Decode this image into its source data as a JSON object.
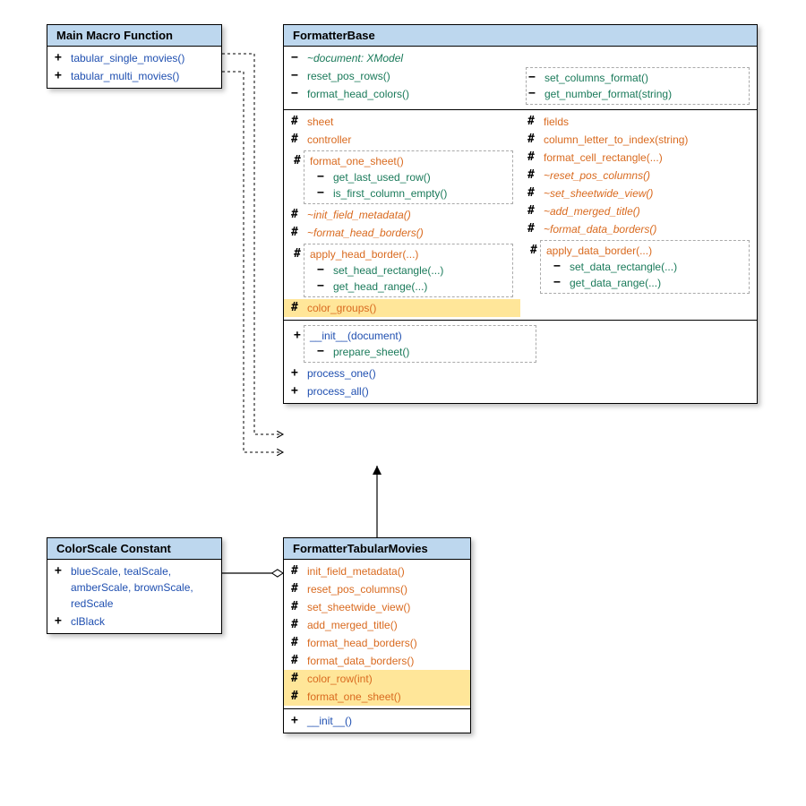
{
  "mainMacro": {
    "title": "Main Macro Function",
    "items": [
      {
        "vis": "+",
        "label": "tabular_single_movies()",
        "cls": "c-public"
      },
      {
        "vis": "+",
        "label": "tabular_multi_movies()",
        "cls": "c-public"
      }
    ]
  },
  "formatterBase": {
    "title": "FormatterBase",
    "privSection": {
      "left": {
        "doc": {
          "vis": "−",
          "label": "~document: XModel",
          "cls": "c-private ital"
        },
        "reset": {
          "vis": "−",
          "label": "reset_pos_rows()",
          "cls": "c-private"
        },
        "fhc": {
          "vis": "−",
          "label": "format_head_colors()",
          "cls": "c-private"
        }
      },
      "right": {
        "scf": {
          "vis": "−",
          "label": "set_columns_format()",
          "cls": "c-private"
        },
        "gnf": {
          "vis": "−",
          "label": "get_number_format(string)",
          "cls": "c-private"
        }
      }
    },
    "protSection": {
      "left": [
        {
          "vis": "#",
          "label": "sheet",
          "cls": "c-protected"
        },
        {
          "vis": "#",
          "label": "controller",
          "cls": "c-protected"
        }
      ],
      "leftNest1": {
        "head": {
          "vis": "#",
          "label": "format_one_sheet()",
          "cls": "c-protected"
        },
        "items": [
          {
            "vis": "−",
            "label": "get_last_used_row()",
            "cls": "c-private"
          },
          {
            "vis": "−",
            "label": "is_first_column_empty()",
            "cls": "c-private"
          }
        ]
      },
      "leftAfter": [
        {
          "vis": "#",
          "label": "~init_field_metadata()",
          "cls": "c-protected ital"
        },
        {
          "vis": "#",
          "label": "~format_head_borders()",
          "cls": "c-protected ital"
        }
      ],
      "leftNest2": {
        "head": {
          "vis": "#",
          "label": "apply_head_border(...)",
          "cls": "c-protected"
        },
        "items": [
          {
            "vis": "−",
            "label": "set_head_rectangle(...)",
            "cls": "c-private"
          },
          {
            "vis": "−",
            "label": "get_head_range(...)",
            "cls": "c-private"
          }
        ]
      },
      "right": [
        {
          "vis": "#",
          "label": "fields",
          "cls": "c-protected"
        },
        {
          "vis": "#",
          "label": "column_letter_to_index(string)",
          "cls": "c-protected"
        },
        {
          "vis": "#",
          "label": "format_cell_rectangle(...)",
          "cls": "c-protected"
        },
        {
          "vis": "#",
          "label": "~reset_pos_columns()",
          "cls": "c-protected ital"
        },
        {
          "vis": "#",
          "label": "~set_sheetwide_view()",
          "cls": "c-protected ital"
        },
        {
          "vis": "#",
          "label": "~add_merged_title()",
          "cls": "c-protected ital"
        },
        {
          "vis": "#",
          "label": "~format_data_borders()",
          "cls": "c-protected ital"
        }
      ],
      "rightNest": {
        "head": {
          "vis": "#",
          "label": "apply_data_border(...)",
          "cls": "c-protected"
        },
        "items": [
          {
            "vis": "−",
            "label": "set_data_rectangle(...)",
            "cls": "c-private"
          },
          {
            "vis": "−",
            "label": "get_data_range(...)",
            "cls": "c-private"
          }
        ]
      },
      "highlight": {
        "vis": "#",
        "label": "color_groups()",
        "cls": "c-protected"
      }
    },
    "pubSection": {
      "nest": {
        "head": {
          "vis": "+",
          "label": "__init__(document)",
          "cls": "c-public"
        },
        "items": [
          {
            "vis": "−",
            "label": "prepare_sheet()",
            "cls": "c-private"
          }
        ]
      },
      "after": [
        {
          "vis": "+",
          "label": "process_one()",
          "cls": "c-public"
        },
        {
          "vis": "+",
          "label": "process_all()",
          "cls": "c-public"
        }
      ]
    }
  },
  "colorScale": {
    "title": "ColorScale Constant",
    "items": [
      {
        "vis": "+",
        "label": "blueScale, tealScale, amberScale, brownScale, redScale",
        "cls": "c-public"
      },
      {
        "vis": "+",
        "label": "clBlack",
        "cls": "c-public"
      }
    ]
  },
  "formatterTabular": {
    "title": "FormatterTabularMovies",
    "prot": [
      {
        "vis": "#",
        "label": "init_field_metadata()",
        "cls": "c-protected"
      },
      {
        "vis": "#",
        "label": "reset_pos_columns()",
        "cls": "c-protected"
      },
      {
        "vis": "#",
        "label": "set_sheetwide_view()",
        "cls": "c-protected"
      },
      {
        "vis": "#",
        "label": "add_merged_title()",
        "cls": "c-protected"
      },
      {
        "vis": "#",
        "label": "format_head_borders()",
        "cls": "c-protected"
      },
      {
        "vis": "#",
        "label": "format_data_borders()",
        "cls": "c-protected"
      }
    ],
    "protHl": [
      {
        "vis": "#",
        "label": "color_row(int)",
        "cls": "c-protected"
      },
      {
        "vis": "#",
        "label": "format_one_sheet()",
        "cls": "c-protected"
      }
    ],
    "pub": [
      {
        "vis": "+",
        "label": "__init__()",
        "cls": "c-public"
      }
    ]
  }
}
